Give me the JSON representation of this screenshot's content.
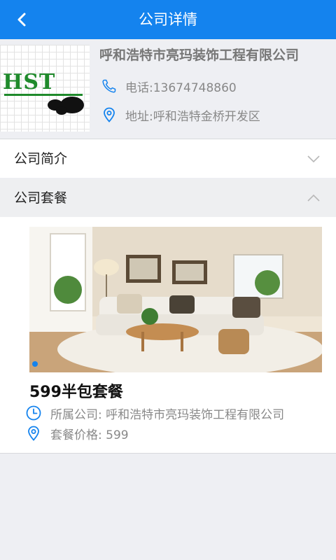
{
  "header": {
    "title": "公司详情",
    "back_icon": "chevron-left-icon"
  },
  "company": {
    "logo_text": "HST",
    "name": "呼和浩特市亮玛装饰工程有限公司",
    "phone_label": "电话:",
    "phone": "13674748860",
    "address_label": "地址:",
    "address": "呼和浩特金桥开发区"
  },
  "sections": {
    "intro_label": "公司简介",
    "packages_label": "公司套餐"
  },
  "package": {
    "title": "599半包套餐",
    "company_label": "所属公司:",
    "company": "呼和浩特市亮玛装饰工程有限公司",
    "price_label": "套餐价格:",
    "price": "599"
  },
  "colors": {
    "accent": "#1483ee",
    "logo_green": "#1f8a2b"
  }
}
